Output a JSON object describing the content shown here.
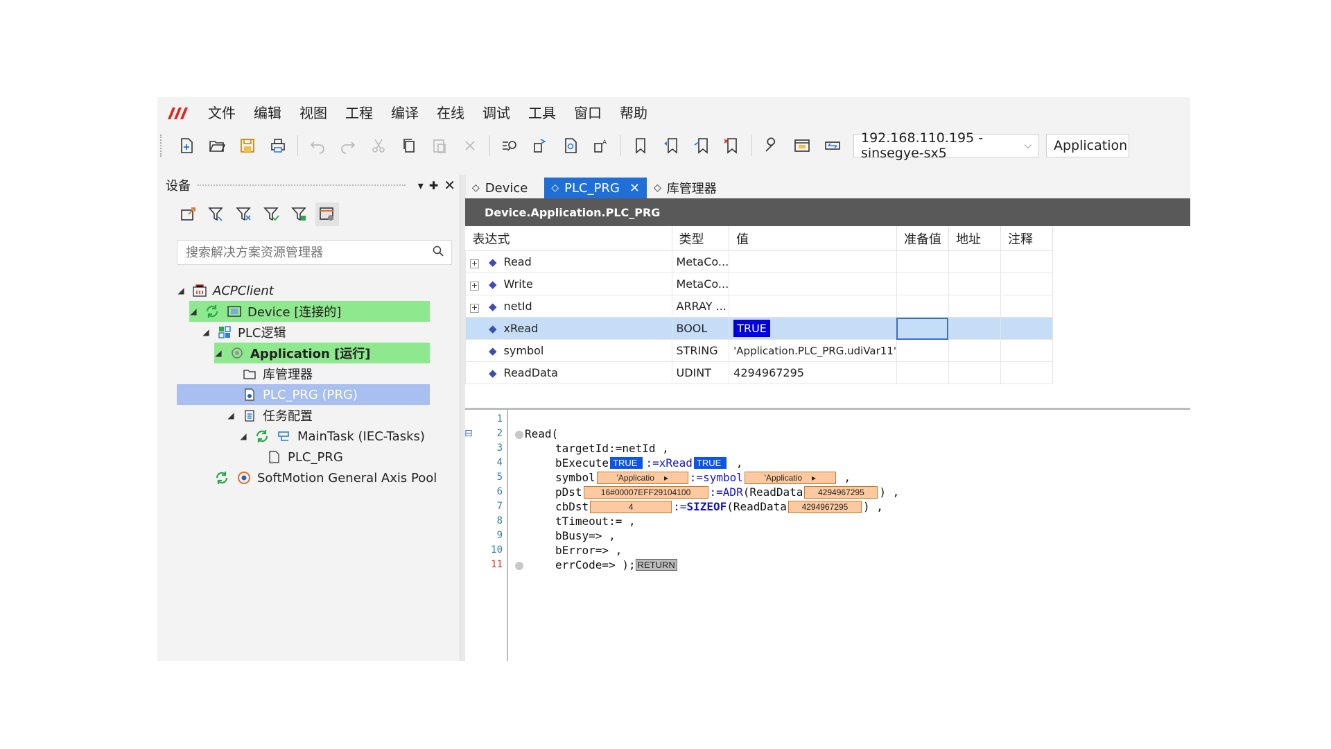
{
  "menu": {
    "items": [
      "文件",
      "编辑",
      "视图",
      "工程",
      "编译",
      "在线",
      "调试",
      "工具",
      "窗口",
      "帮助"
    ]
  },
  "toolbar": {
    "device_combo": "192.168.110.195 - sinsegye-sx5",
    "app_combo": "Application [D"
  },
  "left_panel": {
    "title": "设备",
    "search_placeholder": "搜索解决方案资源管理器",
    "tree": [
      {
        "label": "ACPClient"
      },
      {
        "label": "Device [连接的]"
      },
      {
        "label": "PLC逻辑"
      },
      {
        "label": "Application [运行]"
      },
      {
        "label": "库管理器"
      },
      {
        "label": "PLC_PRG (PRG)"
      },
      {
        "label": "任务配置"
      },
      {
        "label": "MainTask (IEC-Tasks)"
      },
      {
        "label": "PLC_PRG"
      },
      {
        "label": "SoftMotion General Axis Pool"
      }
    ]
  },
  "editor": {
    "tabs": [
      {
        "label": "Device"
      },
      {
        "label": "PLC_PRG"
      },
      {
        "label": "库管理器"
      }
    ],
    "path_title": "Device.Application.PLC_PRG",
    "watch": {
      "columns": [
        "表达式",
        "类型",
        "值",
        "准备值",
        "地址",
        "注释"
      ],
      "rows": [
        {
          "expr": "Read",
          "type": "MetaCo...",
          "value": ""
        },
        {
          "expr": "Write",
          "type": "MetaCo...",
          "value": ""
        },
        {
          "expr": "netId",
          "type": "ARRAY ...",
          "value": ""
        },
        {
          "expr": "xRead",
          "type": "BOOL",
          "value": "TRUE"
        },
        {
          "expr": "symbol",
          "type": "STRING",
          "value": "'Application.PLC_PRG.udiVar11'"
        },
        {
          "expr": "ReadData",
          "type": "UDINT",
          "value": "4294967295"
        }
      ]
    },
    "code": {
      "line_numbers": [
        "1",
        "2",
        "3",
        "4",
        "5",
        "6",
        "7",
        "8",
        "9",
        "10",
        "11"
      ],
      "l2": "Read(",
      "l3": "targetId:=netId ,",
      "l4_a": "bExecute",
      "l4_mv1": "TRUE",
      "l4_b": ":=xRead",
      "l4_mv2": "TRUE",
      "l4_c": " ,",
      "l5_a": "symbol",
      "l5_mv1": "'Applicatio",
      "l5_b": ":=symbol",
      "l5_mv2": "'Applicatio",
      "l5_c": " ,",
      "l6_a": "pDst",
      "l6_mv1": "16#00007EFF29104100",
      "l6_b": ":=",
      "l6_kw": "ADR",
      "l6_c": "(ReadData",
      "l6_mv2": "4294967295",
      "l6_d": ") ,",
      "l7_a": "cbDst",
      "l7_mv1": "4",
      "l7_b": ":=",
      "l7_kw": "SIZEOF",
      "l7_c": "(ReadData",
      "l7_mv2": "4294967295",
      "l7_d": ") ,",
      "l8": "tTimeout:= ,",
      "l9": "bBusy=> ,",
      "l10": "bError=> ,",
      "l11_a": "errCode=> );",
      "l11_ret": "RETURN"
    }
  },
  "colors": {
    "accent": "#1f6fd6",
    "online_green": "#8ee88e",
    "selected_blue": "#a9bff0",
    "true_blue": "#0000dd"
  }
}
